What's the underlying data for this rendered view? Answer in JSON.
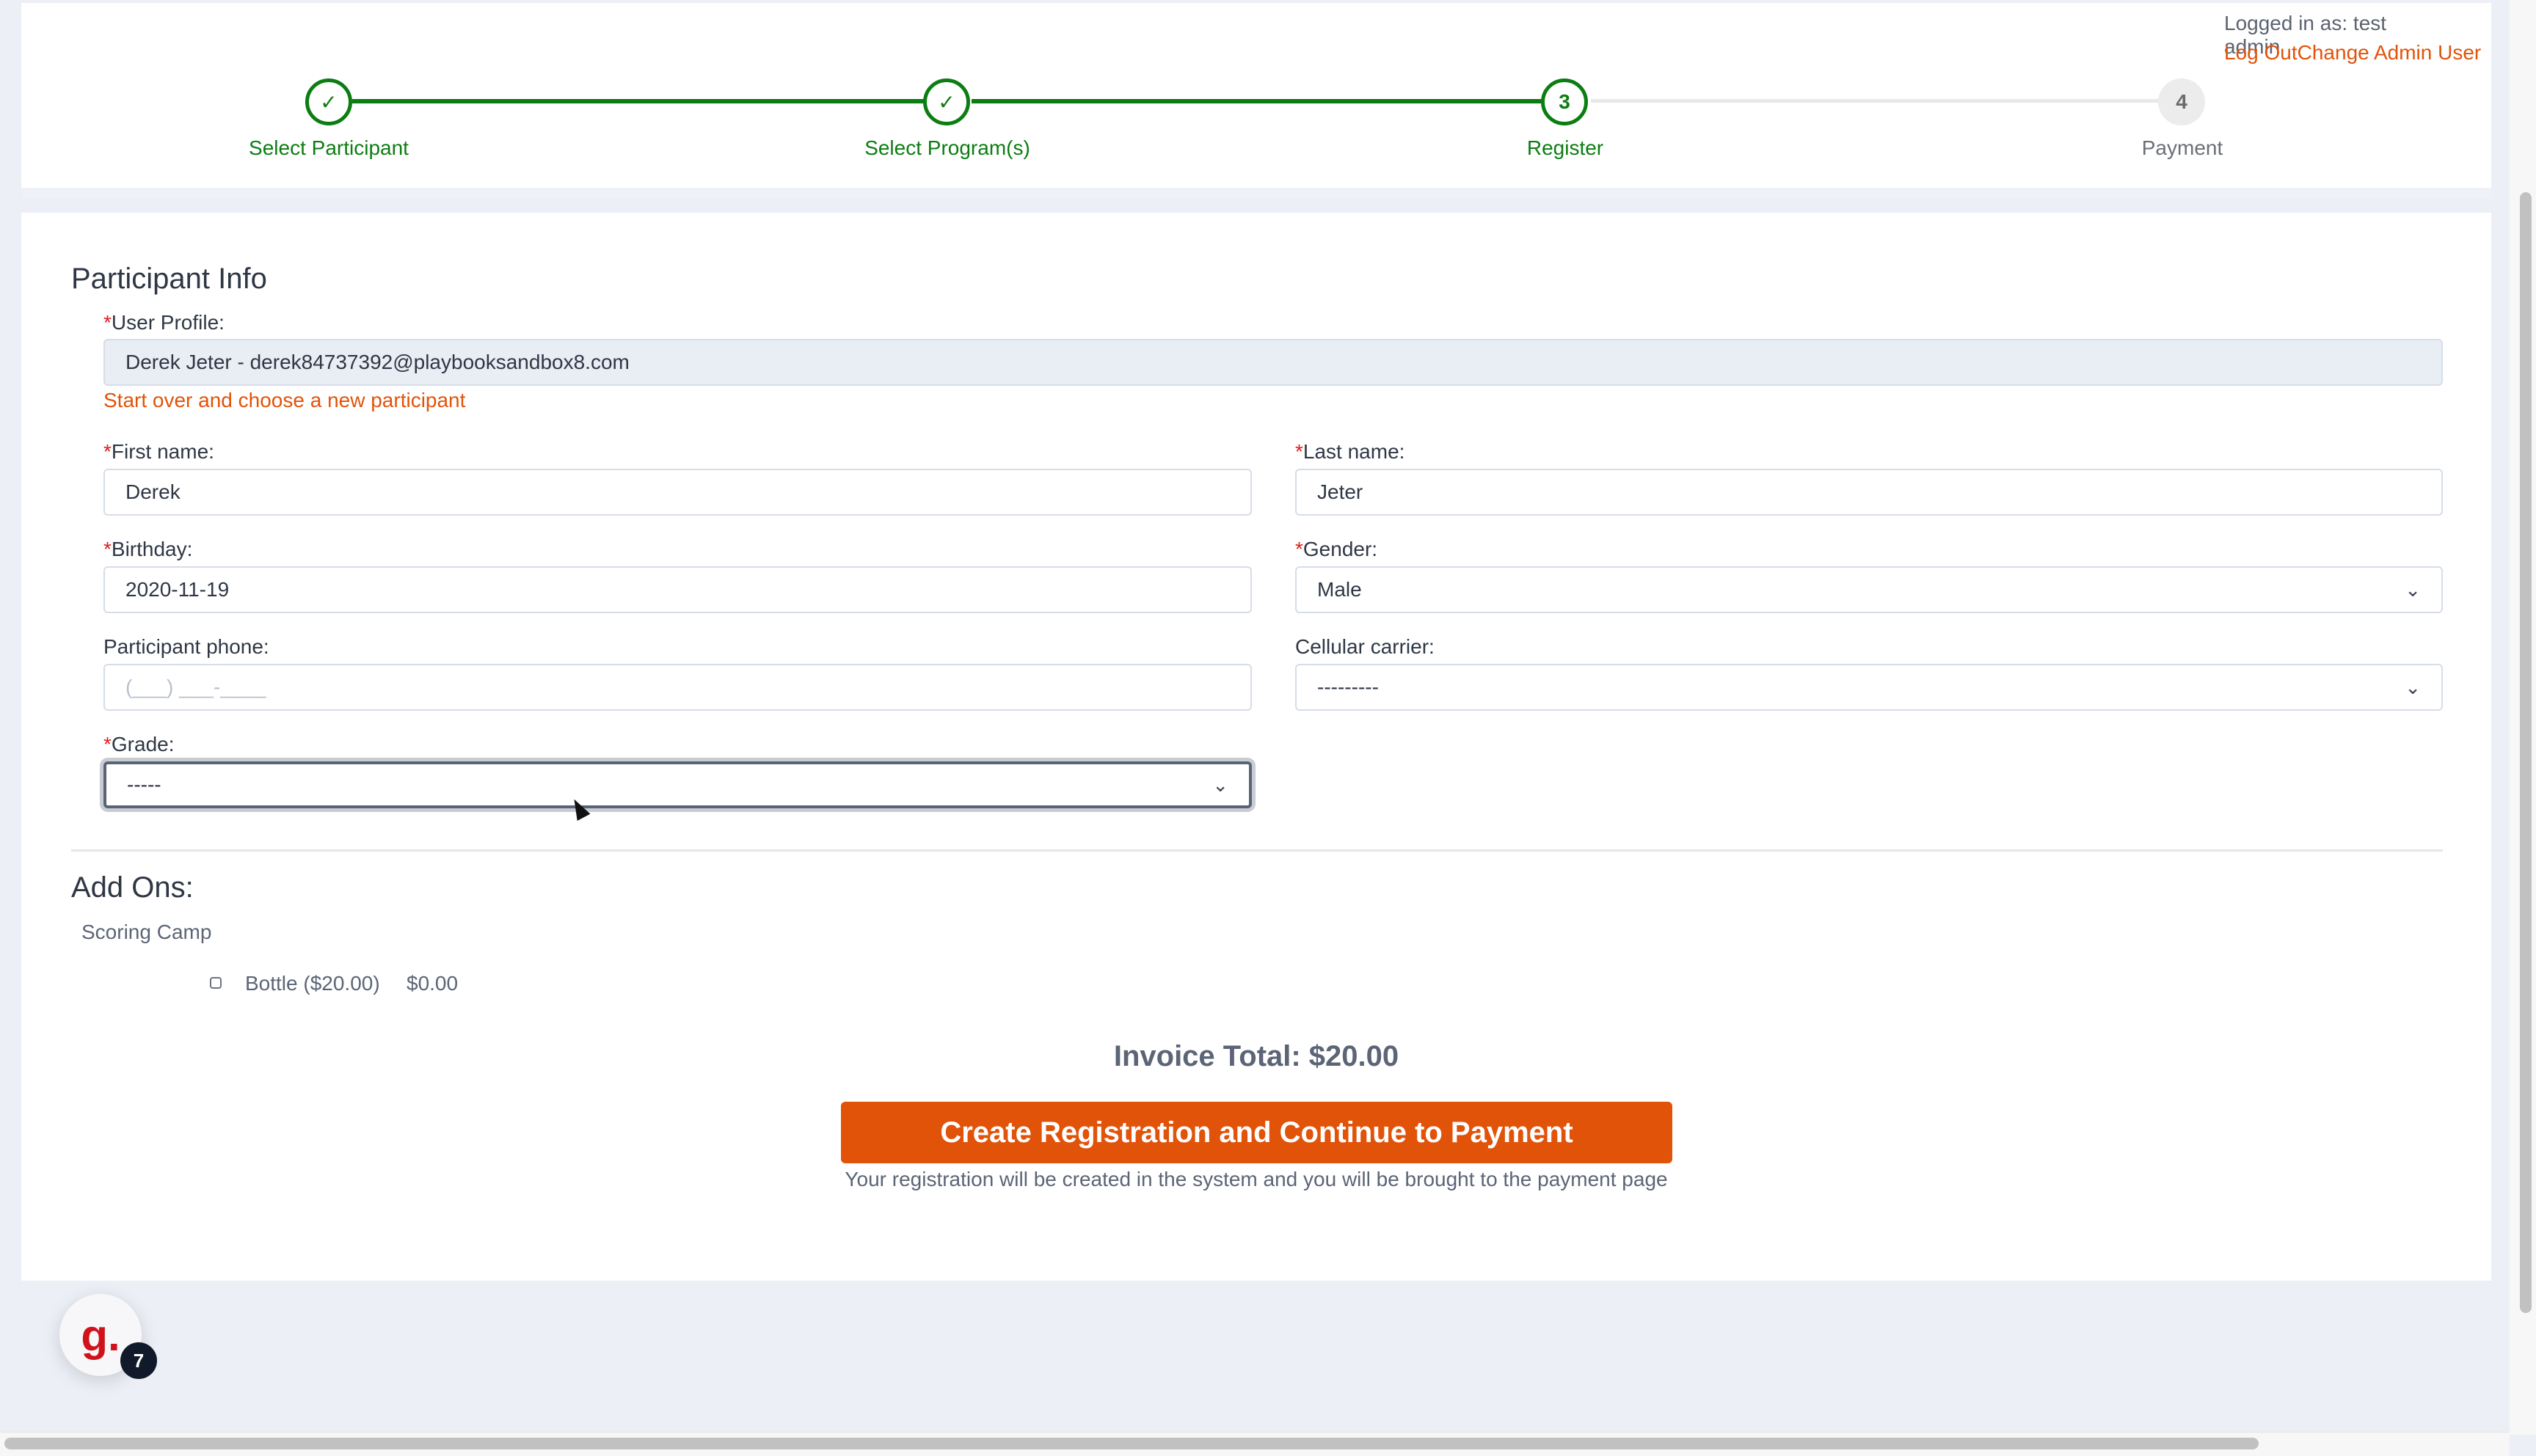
{
  "header": {
    "logged_in_text": "Logged in as: test admin",
    "logout_link": "Log Out",
    "change_admin_link": "Change Admin User"
  },
  "stepper": {
    "steps": [
      {
        "number": "1",
        "label": "Select Participant",
        "state": "done",
        "icon": "check-icon",
        "glyph": "✓"
      },
      {
        "number": "2",
        "label": "Select Program(s)",
        "state": "done",
        "icon": "check-icon",
        "glyph": "✓"
      },
      {
        "number": "3",
        "label": "Register",
        "state": "active",
        "glyph": "3"
      },
      {
        "number": "4",
        "label": "Payment",
        "state": "todo",
        "glyph": "4"
      }
    ],
    "colors": {
      "done": "#0c7d12",
      "todo": "#e8e8e8"
    }
  },
  "participant_info": {
    "title": "Participant Info",
    "required_mark": "*",
    "user_profile": {
      "label": "User Profile:",
      "value": "Derek Jeter - derek84737392@playbooksandbox8.com"
    },
    "start_over_link": "Start over and choose a new participant",
    "first_name": {
      "label": "First name:",
      "value": "Derek"
    },
    "last_name": {
      "label": "Last name:",
      "value": "Jeter"
    },
    "birthday": {
      "label": "Birthday:",
      "value": "2020-11-19"
    },
    "gender": {
      "label": "Gender:",
      "value": "Male"
    },
    "phone": {
      "label": "Participant phone:",
      "placeholder": "(___) ___-____"
    },
    "carrier": {
      "label": "Cellular carrier:",
      "value": "---------"
    },
    "grade": {
      "label": "Grade:",
      "value": "-----"
    }
  },
  "add_ons": {
    "title": "Add Ons:",
    "program": "Scoring Camp",
    "items": [
      {
        "label": "Bottle ($20.00)",
        "amount": "$0.00",
        "checked": false
      }
    ]
  },
  "invoice": {
    "total_text": "Invoice Total: $20.00",
    "cta_label": "Create Registration and Continue to Payment",
    "cta_note": "Your registration will be created in the system and you will be brought to the payment page"
  },
  "widget": {
    "glyph": "g.",
    "badge_count": "7"
  },
  "colors": {
    "accent": "#e2530a",
    "success": "#0c7d12",
    "required": "#e01b1b"
  }
}
